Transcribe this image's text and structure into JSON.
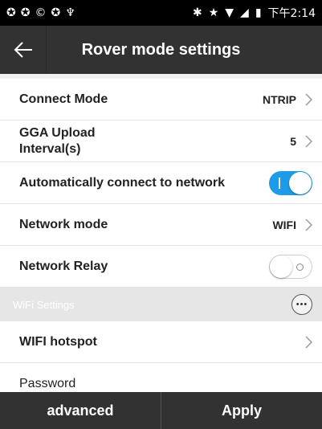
{
  "status_bar": {
    "time": "下午2:14",
    "left_icons": [
      "app-icon",
      "app-icon",
      "app-icon",
      "app-icon",
      "android-icon"
    ],
    "right_icons": [
      "bluetooth-icon",
      "star-icon",
      "wifi-icon",
      "signal-icon",
      "battery-icon"
    ]
  },
  "app_bar": {
    "title": "Rover mode settings",
    "back_icon": "back-arrow-icon"
  },
  "settings": {
    "connect_mode": {
      "label": "Connect Mode",
      "value": "NTRIP"
    },
    "gga_upload": {
      "label_line1": "GGA Upload",
      "label_line2": "Interval(s)",
      "value": "5"
    },
    "auto_connect": {
      "label": "Automatically connect to network",
      "enabled": true
    },
    "network_mode": {
      "label": "Network mode",
      "value": "WIFI"
    },
    "network_relay": {
      "label": "Network Relay",
      "enabled": false
    }
  },
  "wifi_section": {
    "title": "WiFi Settings",
    "more_glyph": "•••",
    "hotspot": {
      "label": "WIFI hotspot"
    },
    "password": {
      "label": "Password"
    }
  },
  "bottom_bar": {
    "advanced_label": "advanced",
    "apply_label": "Apply"
  },
  "colors": {
    "app_bar_bg": "#323232",
    "toggle_on": "#1e9be8",
    "section_bg": "#e6e6e6"
  }
}
